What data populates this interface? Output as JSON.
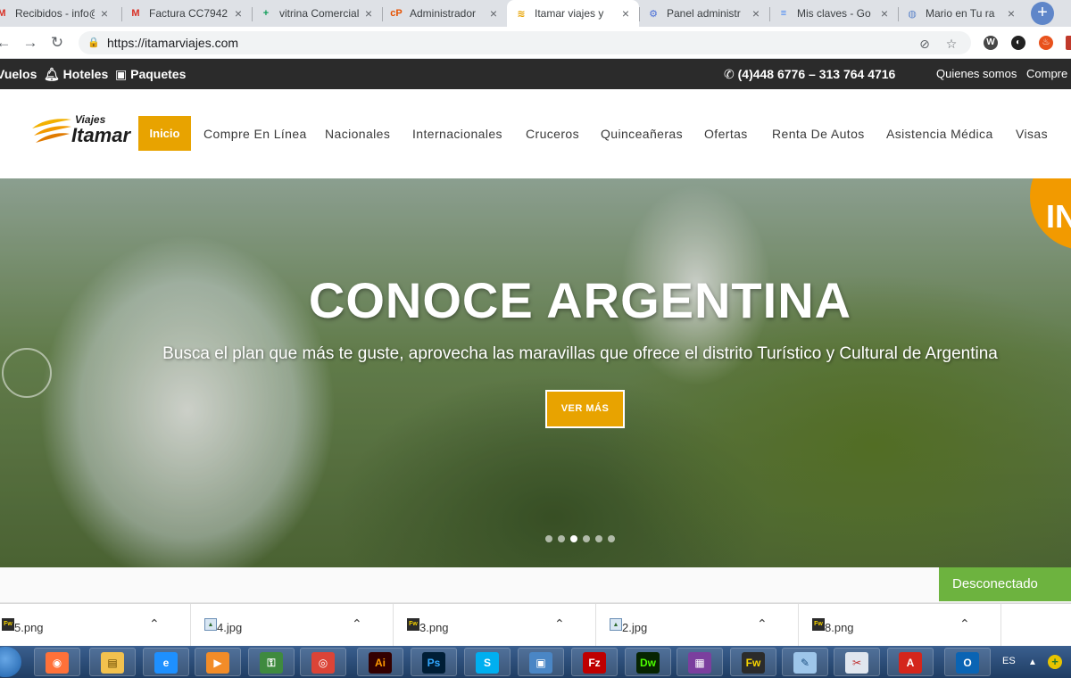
{
  "browser": {
    "tabs": [
      {
        "title": "Recibidos - info@",
        "icon": "gmail-icon",
        "glyph": "M",
        "color": "#d93025"
      },
      {
        "title": "Factura CC7942",
        "icon": "gmail-icon",
        "glyph": "M",
        "color": "#d93025"
      },
      {
        "title": "vitrina Comercial",
        "icon": "sheets-icon",
        "glyph": "+",
        "color": "#0f9d58"
      },
      {
        "title": "Administrador",
        "icon": "cpanel-icon",
        "glyph": "cP",
        "color": "#e65100"
      },
      {
        "title": "Itamar viajes y",
        "icon": "itamar-favicon-icon",
        "glyph": "≋",
        "color": "#e8a300",
        "active": true
      },
      {
        "title": "Panel administr",
        "icon": "panel-icon",
        "glyph": "⚙",
        "color": "#4a6fd6"
      },
      {
        "title": "Mis claves - Go",
        "icon": "docs-icon",
        "glyph": "≡",
        "color": "#4285f4"
      },
      {
        "title": "Mario en Tu ra",
        "icon": "globe-icon",
        "glyph": "◍",
        "color": "#5f86c9"
      }
    ],
    "new_tab": "+",
    "url": "https://itamarviajes.com",
    "lock": "🔒",
    "back": "←",
    "forward": "→",
    "reload": "↻",
    "star": "☆"
  },
  "site": {
    "topbar": {
      "links": [
        "Vuelos",
        "Hoteles",
        "Paquetes"
      ],
      "phone": "(4)448 6776 – 313 764 4716",
      "about": "Quienes somos",
      "buy": "Compre e"
    },
    "logo": {
      "small": "Viajes",
      "big": "Itamar"
    },
    "menu": {
      "active": "Inicio",
      "items": [
        "Compre En Línea",
        "Nacionales",
        "Internacionales",
        "Cruceros",
        "Quinceañeras",
        "Ofertas",
        "Renta De Autos",
        "Asistencia Médica",
        "Visas"
      ]
    },
    "hero": {
      "title": "CONOCE ARGENTINA",
      "subtitle": "Busca el plan que más te guste, aprovecha las maravillas que ofrece el distrito Turístico y Cultural de Argentina",
      "button": "VER MÁS",
      "badge": "IN",
      "slides": 6,
      "current_slide": 3
    },
    "chat": "Desconectado"
  },
  "downloads": [
    {
      "name": "5.png",
      "type": "fw"
    },
    {
      "name": "4.jpg",
      "type": "img"
    },
    {
      "name": "3.png",
      "type": "fw"
    },
    {
      "name": "2.jpg",
      "type": "img"
    },
    {
      "name": "8.png",
      "type": "fw"
    }
  ],
  "taskbar": {
    "apps": [
      {
        "name": "firefox-icon",
        "glyph": "◉",
        "bg": "#ff7139",
        "fg": "#fff"
      },
      {
        "name": "file-explorer-icon",
        "glyph": "▤",
        "bg": "#f2c14e",
        "fg": "#6b4a00"
      },
      {
        "name": "internet-explorer-icon",
        "glyph": "e",
        "bg": "#1e90ff",
        "fg": "#fff"
      },
      {
        "name": "media-player-icon",
        "glyph": "▶",
        "bg": "#f28c28",
        "fg": "#fff"
      },
      {
        "name": "security-icon",
        "glyph": "⚿",
        "bg": "#3f8a3f",
        "fg": "#fff"
      },
      {
        "name": "chrome-icon",
        "glyph": "◎",
        "bg": "#db4437",
        "fg": "#fff"
      },
      {
        "name": "illustrator-icon",
        "glyph": "Ai",
        "bg": "#330000",
        "fg": "#ff9a00"
      },
      {
        "name": "photoshop-icon",
        "glyph": "Ps",
        "bg": "#001e36",
        "fg": "#31a8ff"
      },
      {
        "name": "skype-icon",
        "glyph": "S",
        "bg": "#00aff0",
        "fg": "#fff"
      },
      {
        "name": "photo-viewer-icon",
        "glyph": "▣",
        "bg": "#4a86c5",
        "fg": "#fff"
      },
      {
        "name": "filezilla-icon",
        "glyph": "Fz",
        "bg": "#bf0000",
        "fg": "#fff"
      },
      {
        "name": "dreamweaver-icon",
        "glyph": "Dw",
        "bg": "#072401",
        "fg": "#4cff00"
      },
      {
        "name": "winrar-icon",
        "glyph": "▦",
        "bg": "#7b3f9e",
        "fg": "#fff"
      },
      {
        "name": "fireworks-icon",
        "glyph": "Fw",
        "bg": "#2b2b2b",
        "fg": "#f6d300"
      },
      {
        "name": "notes-icon",
        "glyph": "✎",
        "bg": "#9ec6ea",
        "fg": "#1b4f82"
      },
      {
        "name": "paint-icon",
        "glyph": "✂",
        "bg": "#e0e6ee",
        "fg": "#c03030"
      },
      {
        "name": "acrobat-icon",
        "glyph": "A",
        "bg": "#d4261c",
        "fg": "#fff"
      },
      {
        "name": "outlook-icon",
        "glyph": "O",
        "bg": "#0a64b4",
        "fg": "#fff"
      }
    ],
    "language": "ES",
    "tray_up": "▲"
  }
}
